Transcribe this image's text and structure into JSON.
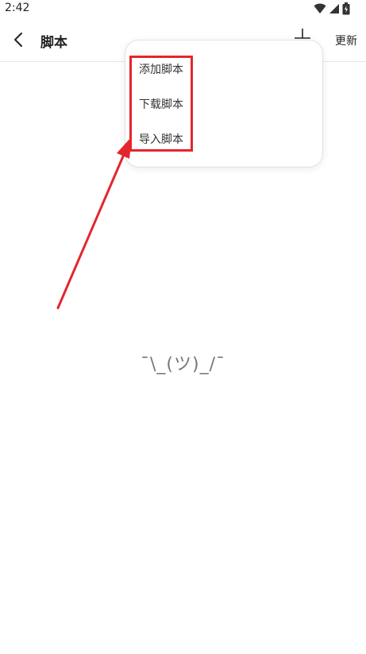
{
  "status_bar": {
    "time": "2:42"
  },
  "header": {
    "title": "脚本",
    "update_label": "更新"
  },
  "menu": {
    "items": [
      {
        "label": "添加脚本"
      },
      {
        "label": "下载脚本"
      },
      {
        "label": "导入脚本"
      }
    ]
  },
  "empty_state": {
    "face": "¯\\_(ツ)_/¯"
  },
  "colors": {
    "annotation": "#e3262c",
    "divider": "#e6e6e6"
  },
  "icons": {
    "back": "chevron-left-icon",
    "wifi": "wifi-icon",
    "signal": "signal-icon",
    "battery": "battery-icon",
    "action": "menu-action-icon"
  }
}
